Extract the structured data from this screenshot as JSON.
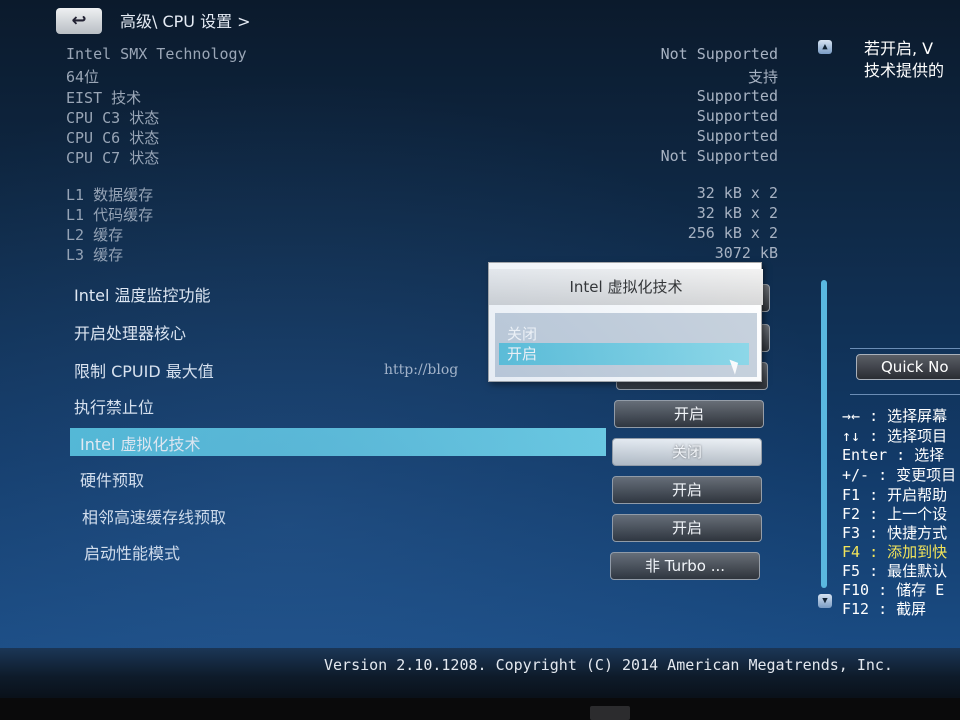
{
  "header": {
    "back_icon": "↩",
    "breadcrumb": "高级\\ CPU 设置 >"
  },
  "info": [
    {
      "label": "Intel SMX Technology",
      "value": "Not Supported"
    },
    {
      "label": "64位",
      "value": "支持"
    },
    {
      "label": "EIST 技术",
      "value": "Supported"
    },
    {
      "label": "CPU C3 状态",
      "value": "Supported"
    },
    {
      "label": "CPU C6 状态",
      "value": "Supported"
    },
    {
      "label": "CPU C7 状态",
      "value": "Not Supported"
    },
    {
      "label": "L1 数据缓存",
      "value": "32 kB x 2"
    },
    {
      "label": "L1 代码缓存",
      "value": "32 kB x 2"
    },
    {
      "label": "L2 缓存",
      "value": "256 kB x 2"
    },
    {
      "label": "L3 缓存",
      "value": "3072 kB"
    }
  ],
  "settings": [
    {
      "label": "Intel 温度监控功能",
      "value": ""
    },
    {
      "label": "开启处理器核心",
      "value": ""
    },
    {
      "label": "限制 CPUID 最大值",
      "value": ""
    },
    {
      "label": "执行禁止位",
      "value": "开启"
    },
    {
      "label": "Intel 虚拟化技术",
      "value": "关闭"
    },
    {
      "label": "硬件预取",
      "value": "开启"
    },
    {
      "label": "相邻高速缓存线预取",
      "value": "开启"
    },
    {
      "label": "启动性能模式",
      "value": "非 Turbo ..."
    }
  ],
  "popup": {
    "title": "Intel 虚拟化技术",
    "options": [
      "关闭",
      "开启"
    ],
    "selected": "开启"
  },
  "help": {
    "description": "若开启, V\n技术提供的"
  },
  "quick_note": "Quick No",
  "keys": [
    "→← : 选择屏幕",
    "↑↓ : 选择项目",
    "Enter : 选择",
    "+/- : 变更项目",
    "F1 : 开启帮助",
    "F2 : 上一个设",
    "F3 : 快捷方式",
    "F4 : 添加到快",
    "F5 : 最佳默认",
    "F10 : 储存  E",
    "F12 : 截屏"
  ],
  "watermark": "http://blog",
  "footer": "Version 2.10.1208. Copyright (C) 2014 American Megatrends, Inc.",
  "colors": {
    "highlight": "#5fc6de",
    "background": "#123a68",
    "f4_key": "#f2e45a"
  }
}
